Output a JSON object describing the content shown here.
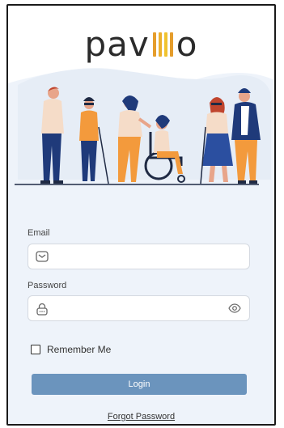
{
  "brand": {
    "prefix": "pav",
    "suffix": "o",
    "bar_colors": [
      "#e59d2c",
      "#ecb02d",
      "#f0c330",
      "#e59d2c"
    ]
  },
  "form": {
    "email_label": "Email",
    "email_value": "",
    "password_label": "Password",
    "password_value": "",
    "remember_label": "Remember Me",
    "remember_checked": false,
    "login_label": "Login",
    "forgot_label": "Forgot Password"
  },
  "icons": {
    "email": "mail-icon",
    "password": "lock-icon",
    "toggle": "eye-icon"
  },
  "colors": {
    "background": "#eef3fa",
    "button": "#6b94bd",
    "brand_text": "#2b2b2b",
    "brand_accent": "#e59d2c"
  }
}
